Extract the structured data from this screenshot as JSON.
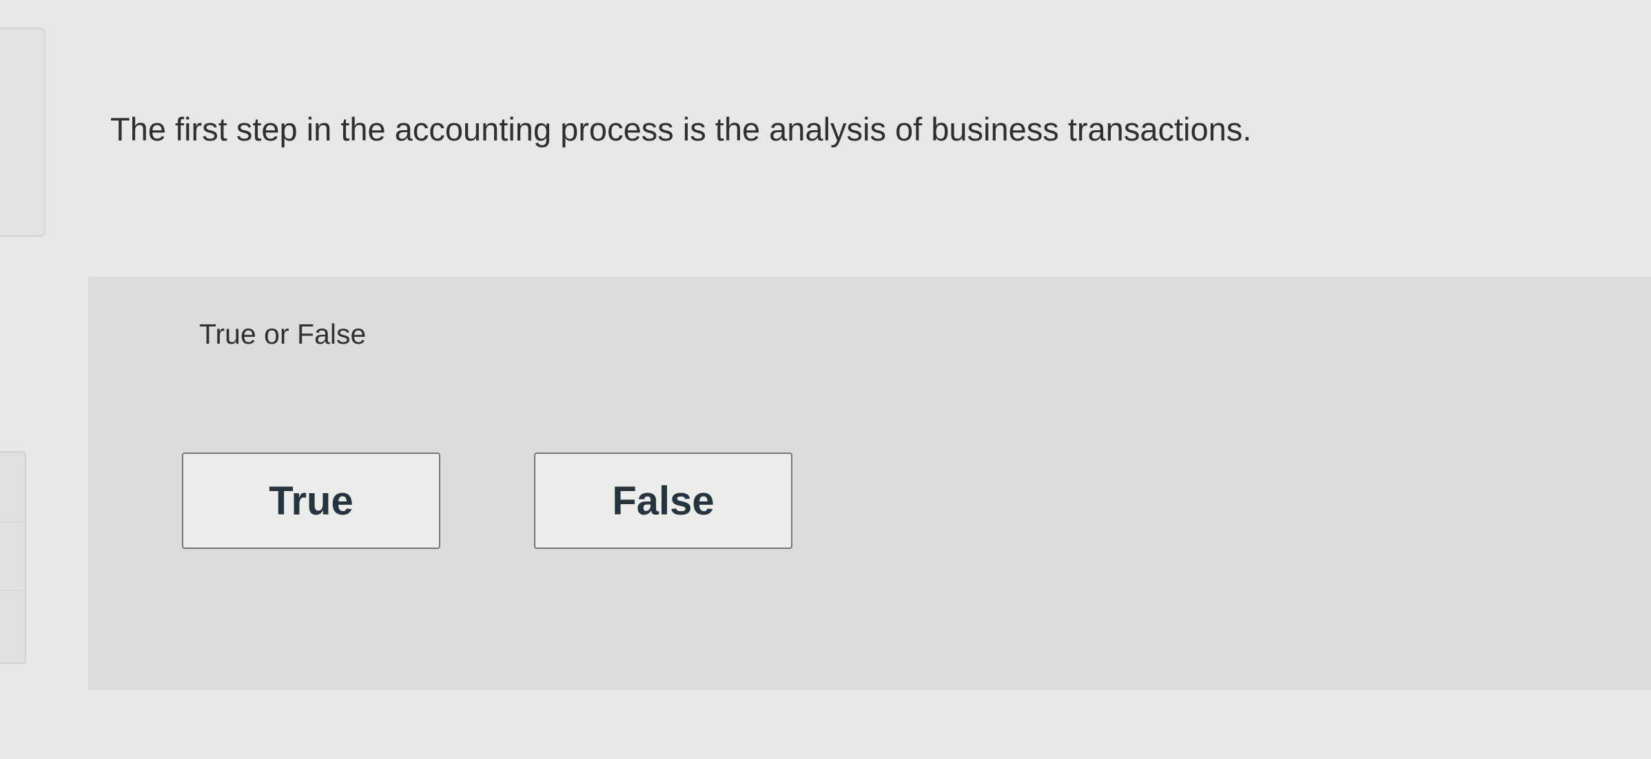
{
  "question": {
    "text": "The first step in the accounting process is the analysis of business transactions."
  },
  "answer_panel": {
    "prompt": "True or False",
    "choices": [
      {
        "label": "True"
      },
      {
        "label": "False"
      }
    ]
  }
}
